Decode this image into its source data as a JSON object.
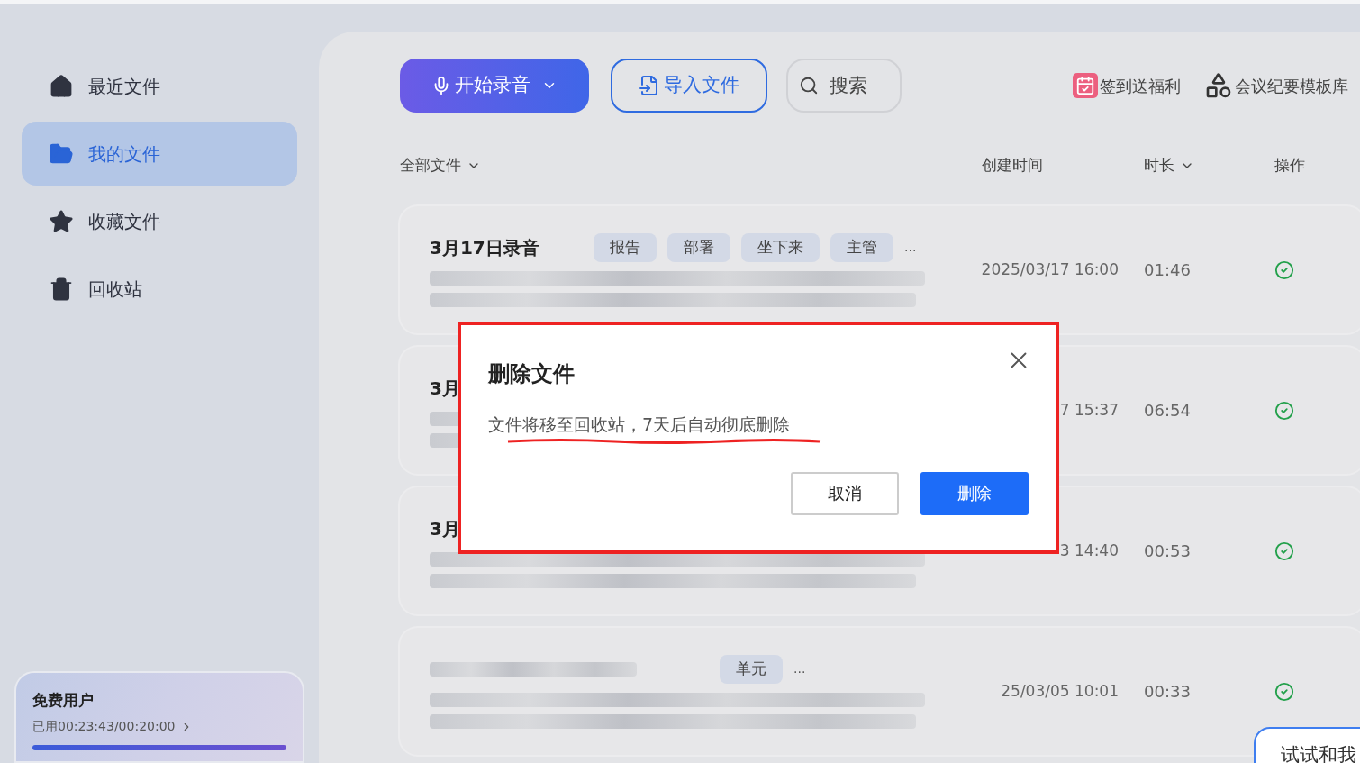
{
  "sidebar": {
    "items": [
      {
        "label": "最近文件",
        "selected": false
      },
      {
        "label": "我的文件",
        "selected": true
      },
      {
        "label": "收藏文件",
        "selected": false
      },
      {
        "label": "回收站",
        "selected": false
      }
    ]
  },
  "plan_card": {
    "title": "免费用户",
    "usage": "已用00:23:43/00:20:00",
    "level": 1
  },
  "toolbar": {
    "record_button": "开始录音",
    "import_button": "导入文件",
    "search": {
      "placeholder": "搜索"
    },
    "links": [
      {
        "label": "签到送福利"
      },
      {
        "label": "会议纪要模板库"
      }
    ]
  },
  "columns": [
    {
      "label": "全部文件",
      "dropdown": true
    },
    {
      "label": "创建时间",
      "dropdown": false
    },
    {
      "label": "时长",
      "dropdown": true
    },
    {
      "label": "操作",
      "dropdown": false
    }
  ],
  "rows": [
    {
      "title": "3月17日录音",
      "tags": [
        "报告",
        "部署",
        "坐下来",
        "主管"
      ],
      "more": "...",
      "created": "2025/03/17 16:00",
      "duration": "01:46",
      "done": true
    },
    {
      "title": "3月",
      "tags": [],
      "created": "7 15:37",
      "duration": "06:54",
      "done": true
    },
    {
      "title": "3月",
      "tags": [],
      "created": "3 14:40",
      "duration": "00:53",
      "done": true
    },
    {
      "tags": [
        "单元"
      ],
      "more": "...",
      "created": "25/03/05 10:01",
      "duration": "00:33",
      "done": true
    }
  ],
  "dialog": {
    "title": "删除文件",
    "message": "文件将移至回收站，7天后自动彻底删除",
    "annotated": true,
    "buttons": [
      {
        "label": "取消",
        "kind": "secondary"
      },
      {
        "label": "删除",
        "kind": "primary"
      }
    ]
  },
  "popup": {
    "label": "试试和我"
  }
}
